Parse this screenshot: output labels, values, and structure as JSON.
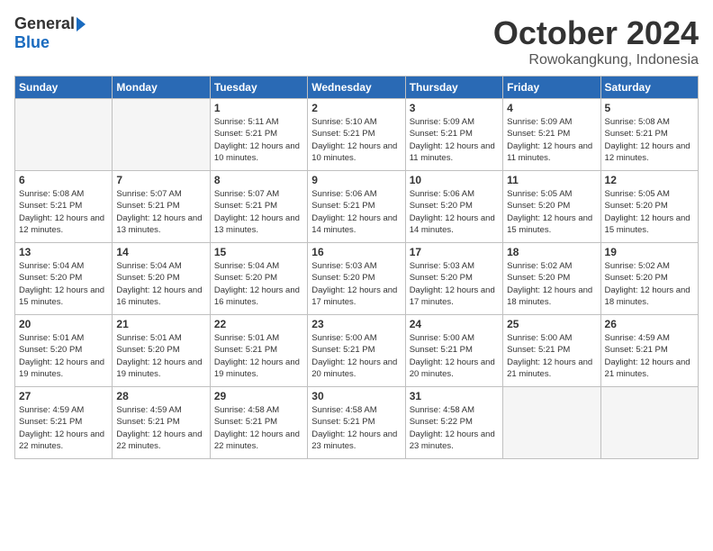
{
  "header": {
    "logo_general": "General",
    "logo_blue": "Blue",
    "month_title": "October 2024",
    "location": "Rowokangkung, Indonesia"
  },
  "weekdays": [
    "Sunday",
    "Monday",
    "Tuesday",
    "Wednesday",
    "Thursday",
    "Friday",
    "Saturday"
  ],
  "weeks": [
    [
      {
        "day": null
      },
      {
        "day": null
      },
      {
        "day": 1,
        "sunrise": "Sunrise: 5:11 AM",
        "sunset": "Sunset: 5:21 PM",
        "daylight": "Daylight: 12 hours and 10 minutes."
      },
      {
        "day": 2,
        "sunrise": "Sunrise: 5:10 AM",
        "sunset": "Sunset: 5:21 PM",
        "daylight": "Daylight: 12 hours and 10 minutes."
      },
      {
        "day": 3,
        "sunrise": "Sunrise: 5:09 AM",
        "sunset": "Sunset: 5:21 PM",
        "daylight": "Daylight: 12 hours and 11 minutes."
      },
      {
        "day": 4,
        "sunrise": "Sunrise: 5:09 AM",
        "sunset": "Sunset: 5:21 PM",
        "daylight": "Daylight: 12 hours and 11 minutes."
      },
      {
        "day": 5,
        "sunrise": "Sunrise: 5:08 AM",
        "sunset": "Sunset: 5:21 PM",
        "daylight": "Daylight: 12 hours and 12 minutes."
      }
    ],
    [
      {
        "day": 6,
        "sunrise": "Sunrise: 5:08 AM",
        "sunset": "Sunset: 5:21 PM",
        "daylight": "Daylight: 12 hours and 12 minutes."
      },
      {
        "day": 7,
        "sunrise": "Sunrise: 5:07 AM",
        "sunset": "Sunset: 5:21 PM",
        "daylight": "Daylight: 12 hours and 13 minutes."
      },
      {
        "day": 8,
        "sunrise": "Sunrise: 5:07 AM",
        "sunset": "Sunset: 5:21 PM",
        "daylight": "Daylight: 12 hours and 13 minutes."
      },
      {
        "day": 9,
        "sunrise": "Sunrise: 5:06 AM",
        "sunset": "Sunset: 5:21 PM",
        "daylight": "Daylight: 12 hours and 14 minutes."
      },
      {
        "day": 10,
        "sunrise": "Sunrise: 5:06 AM",
        "sunset": "Sunset: 5:20 PM",
        "daylight": "Daylight: 12 hours and 14 minutes."
      },
      {
        "day": 11,
        "sunrise": "Sunrise: 5:05 AM",
        "sunset": "Sunset: 5:20 PM",
        "daylight": "Daylight: 12 hours and 15 minutes."
      },
      {
        "day": 12,
        "sunrise": "Sunrise: 5:05 AM",
        "sunset": "Sunset: 5:20 PM",
        "daylight": "Daylight: 12 hours and 15 minutes."
      }
    ],
    [
      {
        "day": 13,
        "sunrise": "Sunrise: 5:04 AM",
        "sunset": "Sunset: 5:20 PM",
        "daylight": "Daylight: 12 hours and 15 minutes."
      },
      {
        "day": 14,
        "sunrise": "Sunrise: 5:04 AM",
        "sunset": "Sunset: 5:20 PM",
        "daylight": "Daylight: 12 hours and 16 minutes."
      },
      {
        "day": 15,
        "sunrise": "Sunrise: 5:04 AM",
        "sunset": "Sunset: 5:20 PM",
        "daylight": "Daylight: 12 hours and 16 minutes."
      },
      {
        "day": 16,
        "sunrise": "Sunrise: 5:03 AM",
        "sunset": "Sunset: 5:20 PM",
        "daylight": "Daylight: 12 hours and 17 minutes."
      },
      {
        "day": 17,
        "sunrise": "Sunrise: 5:03 AM",
        "sunset": "Sunset: 5:20 PM",
        "daylight": "Daylight: 12 hours and 17 minutes."
      },
      {
        "day": 18,
        "sunrise": "Sunrise: 5:02 AM",
        "sunset": "Sunset: 5:20 PM",
        "daylight": "Daylight: 12 hours and 18 minutes."
      },
      {
        "day": 19,
        "sunrise": "Sunrise: 5:02 AM",
        "sunset": "Sunset: 5:20 PM",
        "daylight": "Daylight: 12 hours and 18 minutes."
      }
    ],
    [
      {
        "day": 20,
        "sunrise": "Sunrise: 5:01 AM",
        "sunset": "Sunset: 5:20 PM",
        "daylight": "Daylight: 12 hours and 19 minutes."
      },
      {
        "day": 21,
        "sunrise": "Sunrise: 5:01 AM",
        "sunset": "Sunset: 5:20 PM",
        "daylight": "Daylight: 12 hours and 19 minutes."
      },
      {
        "day": 22,
        "sunrise": "Sunrise: 5:01 AM",
        "sunset": "Sunset: 5:21 PM",
        "daylight": "Daylight: 12 hours and 19 minutes."
      },
      {
        "day": 23,
        "sunrise": "Sunrise: 5:00 AM",
        "sunset": "Sunset: 5:21 PM",
        "daylight": "Daylight: 12 hours and 20 minutes."
      },
      {
        "day": 24,
        "sunrise": "Sunrise: 5:00 AM",
        "sunset": "Sunset: 5:21 PM",
        "daylight": "Daylight: 12 hours and 20 minutes."
      },
      {
        "day": 25,
        "sunrise": "Sunrise: 5:00 AM",
        "sunset": "Sunset: 5:21 PM",
        "daylight": "Daylight: 12 hours and 21 minutes."
      },
      {
        "day": 26,
        "sunrise": "Sunrise: 4:59 AM",
        "sunset": "Sunset: 5:21 PM",
        "daylight": "Daylight: 12 hours and 21 minutes."
      }
    ],
    [
      {
        "day": 27,
        "sunrise": "Sunrise: 4:59 AM",
        "sunset": "Sunset: 5:21 PM",
        "daylight": "Daylight: 12 hours and 22 minutes."
      },
      {
        "day": 28,
        "sunrise": "Sunrise: 4:59 AM",
        "sunset": "Sunset: 5:21 PM",
        "daylight": "Daylight: 12 hours and 22 minutes."
      },
      {
        "day": 29,
        "sunrise": "Sunrise: 4:58 AM",
        "sunset": "Sunset: 5:21 PM",
        "daylight": "Daylight: 12 hours and 22 minutes."
      },
      {
        "day": 30,
        "sunrise": "Sunrise: 4:58 AM",
        "sunset": "Sunset: 5:21 PM",
        "daylight": "Daylight: 12 hours and 23 minutes."
      },
      {
        "day": 31,
        "sunrise": "Sunrise: 4:58 AM",
        "sunset": "Sunset: 5:22 PM",
        "daylight": "Daylight: 12 hours and 23 minutes."
      },
      {
        "day": null
      },
      {
        "day": null
      }
    ]
  ]
}
